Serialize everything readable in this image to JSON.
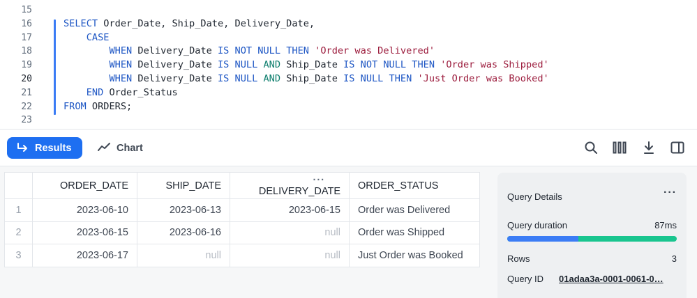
{
  "editor": {
    "line_numbers": [
      "15",
      "16",
      "17",
      "18",
      "19",
      "20",
      "21",
      "22",
      "23"
    ],
    "active_line": "20",
    "lines": [
      [],
      [
        {
          "t": "SELECT",
          "c": "kw"
        },
        {
          "t": " Order_Date, Ship_Date, Delivery_Date,",
          "c": ""
        }
      ],
      [
        {
          "t": "    ",
          "c": ""
        },
        {
          "t": "CASE",
          "c": "kw"
        }
      ],
      [
        {
          "t": "        ",
          "c": ""
        },
        {
          "t": "WHEN",
          "c": "kw"
        },
        {
          "t": " Delivery_Date ",
          "c": ""
        },
        {
          "t": "IS NOT NULL THEN",
          "c": "kw"
        },
        {
          "t": " ",
          "c": ""
        },
        {
          "t": "'Order was Delivered'",
          "c": "str"
        }
      ],
      [
        {
          "t": "        ",
          "c": ""
        },
        {
          "t": "WHEN",
          "c": "kw"
        },
        {
          "t": " Delivery_Date ",
          "c": ""
        },
        {
          "t": "IS NULL",
          "c": "kw"
        },
        {
          "t": " ",
          "c": ""
        },
        {
          "t": "AND",
          "c": "kw2"
        },
        {
          "t": " Ship_Date ",
          "c": ""
        },
        {
          "t": "IS NOT NULL THEN",
          "c": "kw"
        },
        {
          "t": " ",
          "c": ""
        },
        {
          "t": "'Order was Shipped'",
          "c": "str"
        }
      ],
      [
        {
          "t": "        ",
          "c": ""
        },
        {
          "t": "WHEN",
          "c": "kw"
        },
        {
          "t": " Delivery_Date ",
          "c": ""
        },
        {
          "t": "IS NULL",
          "c": "kw"
        },
        {
          "t": " ",
          "c": ""
        },
        {
          "t": "AND",
          "c": "kw2"
        },
        {
          "t": " Ship_Date ",
          "c": ""
        },
        {
          "t": "IS NULL THEN",
          "c": "kw"
        },
        {
          "t": " ",
          "c": ""
        },
        {
          "t": "'Just Order was Booked'",
          "c": "str"
        }
      ],
      [
        {
          "t": "    ",
          "c": ""
        },
        {
          "t": "END",
          "c": "kw"
        },
        {
          "t": " Order_Status",
          "c": ""
        }
      ],
      [
        {
          "t": "FROM",
          "c": "kw"
        },
        {
          "t": " ORDERS;",
          "c": ""
        }
      ],
      []
    ]
  },
  "toolbar": {
    "results_label": "Results",
    "chart_label": "Chart",
    "icons": [
      "search-icon",
      "columns-icon",
      "download-icon",
      "split-panel-icon"
    ]
  },
  "grid": {
    "columns": [
      "ORDER_DATE",
      "SHIP_DATE",
      "DELIVERY_DATE",
      "ORDER_STATUS"
    ],
    "rows": [
      {
        "idx": "1",
        "order_date": "2023-06-10",
        "ship_date": "2023-06-13",
        "delivery_date": "2023-06-15",
        "status": "Order was Delivered"
      },
      {
        "idx": "2",
        "order_date": "2023-06-15",
        "ship_date": "2023-06-16",
        "delivery_date": "null",
        "status": "Order was Shipped"
      },
      {
        "idx": "3",
        "order_date": "2023-06-17",
        "ship_date": "null",
        "delivery_date": "null",
        "status": "Just Order was Booked"
      }
    ]
  },
  "details": {
    "title": "Query Details",
    "duration_label": "Query duration",
    "duration_value": "87ms",
    "duration_split": 0.42,
    "rows_label": "Rows",
    "rows_value": "3",
    "query_id_label": "Query ID",
    "query_id_value": "01adaa3a-0001-0061-0…"
  },
  "colors": {
    "accent": "#1e6ff1",
    "bar_primary": "#3b7cf5",
    "bar_secondary": "#19c58f",
    "keyword": "#1d56c4",
    "string": "#9c1c3d"
  }
}
